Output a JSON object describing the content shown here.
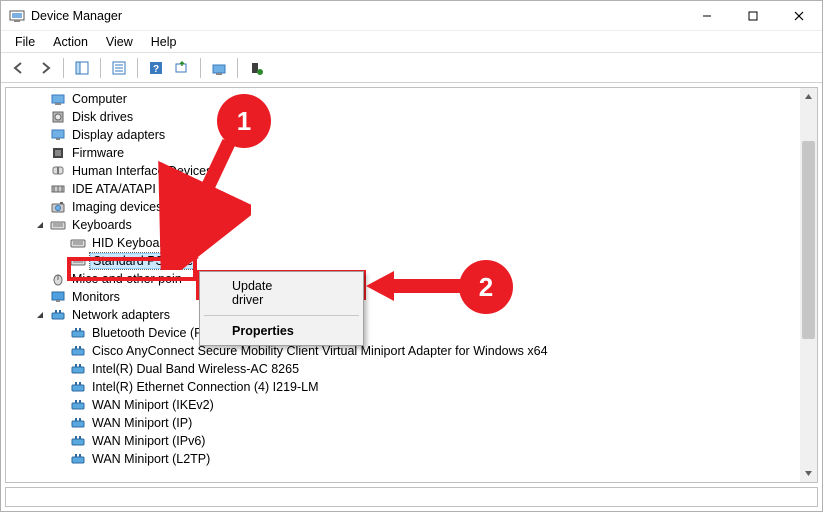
{
  "window": {
    "title": "Device Manager"
  },
  "menubar": {
    "items": [
      "File",
      "Action",
      "View",
      "Help"
    ]
  },
  "tree": {
    "root_expanded": true,
    "nodes": [
      {
        "label": "Computer",
        "icon": "computer",
        "depth": 1,
        "children": false
      },
      {
        "label": "Disk drives",
        "icon": "disk",
        "depth": 1,
        "children": false
      },
      {
        "label": "Display adapters",
        "icon": "display",
        "depth": 1,
        "children": false
      },
      {
        "label": "Firmware",
        "icon": "chip",
        "depth": 1,
        "children": false
      },
      {
        "label": "Human Interface Devices",
        "icon": "hid",
        "depth": 1,
        "children": false
      },
      {
        "label": "IDE ATA/ATAPI controll",
        "icon": "ide",
        "depth": 1,
        "children": false
      },
      {
        "label": "Imaging devices",
        "icon": "camera",
        "depth": 1,
        "children": false
      },
      {
        "label": "Keyboards",
        "icon": "keyboard",
        "depth": 1,
        "children": true,
        "expanded": true
      },
      {
        "label": "HID Keyboard Device",
        "icon": "keyboard",
        "depth": 2,
        "children": false
      },
      {
        "label": "Standard PS/2 Ke",
        "icon": "keyboard",
        "depth": 2,
        "children": false,
        "selected": true
      },
      {
        "label": "Mice and other poin",
        "icon": "mouse",
        "depth": 1,
        "children": false
      },
      {
        "label": "Monitors",
        "icon": "monitor",
        "depth": 1,
        "children": false
      },
      {
        "label": "Network adapters",
        "icon": "network",
        "depth": 1,
        "children": true,
        "expanded": true
      },
      {
        "label": "Bluetooth Device (Personal Area Network)",
        "icon": "network",
        "depth": 2
      },
      {
        "label": "Cisco AnyConnect Secure Mobility Client Virtual Miniport Adapter for Windows x64",
        "icon": "network",
        "depth": 2
      },
      {
        "label": "Intel(R) Dual Band Wireless-AC 8265",
        "icon": "network",
        "depth": 2
      },
      {
        "label": "Intel(R) Ethernet Connection (4) I219-LM",
        "icon": "network",
        "depth": 2
      },
      {
        "label": "WAN Miniport (IKEv2)",
        "icon": "network",
        "depth": 2
      },
      {
        "label": "WAN Miniport (IP)",
        "icon": "network",
        "depth": 2
      },
      {
        "label": "WAN Miniport (IPv6)",
        "icon": "network",
        "depth": 2
      },
      {
        "label": "WAN Miniport (L2TP)",
        "icon": "network",
        "depth": 2
      }
    ]
  },
  "context_menu": {
    "items": [
      {
        "label": "Update driver",
        "highlight": true
      },
      {
        "label": "Properties",
        "bold": true
      }
    ]
  },
  "annotations": {
    "step1": "1",
    "step2": "2"
  },
  "scrollbar": {
    "thumb_top_pct": 10,
    "thumb_height_pct": 55
  }
}
